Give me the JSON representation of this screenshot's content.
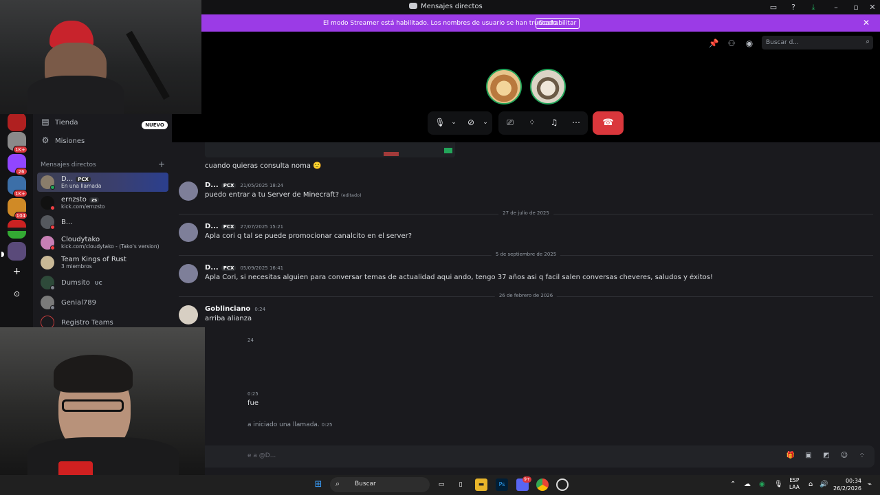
{
  "window": {
    "title": "Mensajes directos"
  },
  "banner": {
    "text": "El modo Streamer está habilitado. Los nombres de usuario se han truncado.",
    "button": "Deshabilitar"
  },
  "header": {
    "search_placeholder": "Buscar d..."
  },
  "sidebar": {
    "servers": [
      {
        "badge": "1K+"
      },
      {
        "badge": "26"
      },
      {
        "badge": "1K+"
      },
      {
        "badge": "104"
      }
    ],
    "nav": [
      {
        "label": "Tienda",
        "badge": "NUEVO"
      },
      {
        "label": "Misiones"
      }
    ],
    "dm_header": "Mensajes directos",
    "dms": [
      {
        "name": "D...",
        "tag": "PCX",
        "sub": "En una llamada"
      },
      {
        "name": "ernzsto",
        "tag": "zs",
        "sub": "kick.com/ernzsto"
      },
      {
        "name": "B...",
        "sub": ""
      },
      {
        "name": "Cloudytako",
        "sub": "kick.com/cloudytako - (Tako's version)"
      },
      {
        "name": "Team Kings of Rust",
        "sub": "3 miembros"
      },
      {
        "name": "Dumsito",
        "tag": "UC",
        "sub": ""
      },
      {
        "name": "Genial789",
        "sub": ""
      },
      {
        "name": "Registro Teams",
        "sub": ""
      }
    ]
  },
  "chat": {
    "messages": [
      {
        "text": "cuando quieras consulta noma"
      },
      {
        "author": "D...",
        "tag": "PCX",
        "time": "21/05/2025 18:24",
        "text": "puedo entrar a tu Server de Minecraft?",
        "edited": "(editado)"
      },
      {
        "divider": "27 de julio de 2025"
      },
      {
        "author": "D...",
        "tag": "PCX",
        "time": "27/07/2025 15:21",
        "text": "Apla cori q tal se puede promocionar canalcito en el server?"
      },
      {
        "divider": "5 de septiembre de 2025"
      },
      {
        "author": "D...",
        "tag": "PCX",
        "time": "05/09/2025 16:41",
        "text": "Apla Cori, si necesitas alguien para conversar temas de actualidad aqui ando, tengo 37 años asi q facil salen conversas cheveres, saludos y éxitos!"
      },
      {
        "divider": "26 de febrero de 2026"
      },
      {
        "author": "Goblinciano",
        "time": "0:24",
        "text": "arriba alianza"
      },
      {
        "partial_time_1": "24"
      },
      {
        "partial_time_2": "0:25",
        "text": "fue"
      },
      {
        "system": "a iniciado una llamada.",
        "time": "0:25"
      }
    ],
    "composer_placeholder": "e a @D..."
  },
  "taskbar": {
    "search": "Buscar",
    "lang_1": "ESP",
    "lang_2": "LAA",
    "time": "00:34",
    "date": "26/2/2026",
    "discord_badge": "9+"
  }
}
